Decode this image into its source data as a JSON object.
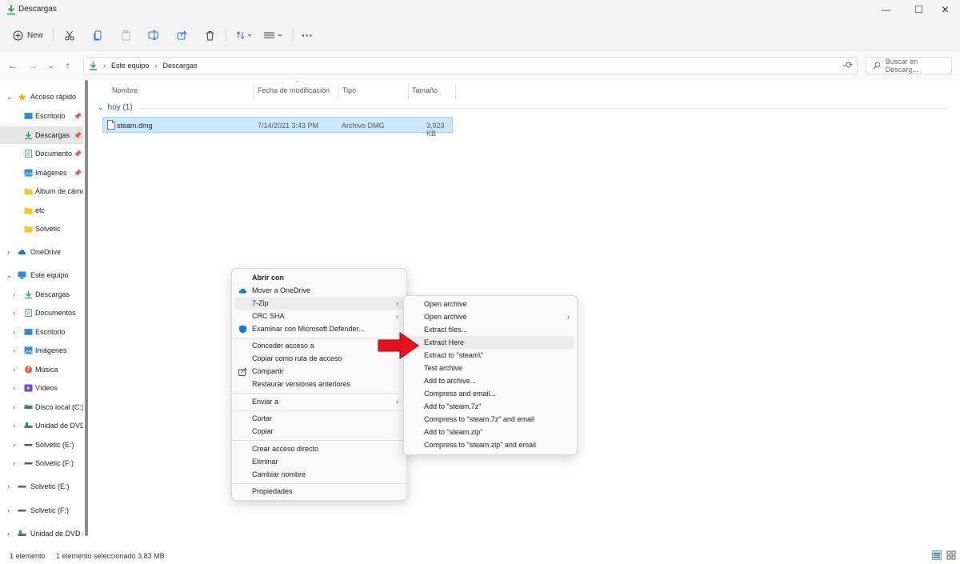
{
  "window": {
    "title": "Descargas",
    "minimize": "—",
    "maximize": "☐",
    "close": "✕"
  },
  "toolbar": {
    "new_label": "New"
  },
  "address": {
    "root": "Este equipo",
    "current": "Descargas",
    "search_placeholder": "Buscar en Descarg..."
  },
  "nav": {
    "quick_access": "Acceso rápido",
    "quick_items": [
      "Escritorio",
      "Descargas",
      "Documento",
      "Imágenes",
      "Álbum de cáma",
      "etc",
      "Solvetic"
    ],
    "onedrive": "OneDrive",
    "this_pc": "Este equipo",
    "pc_items": [
      "Descargas",
      "Documentos",
      "Escritorio",
      "Imágenes",
      "Música",
      "Vídeos",
      "Disco local (C:)",
      "Unidad de DVD",
      "Solvetic (E:)",
      "Solvetic (F:)"
    ],
    "root_items": [
      "Solvetic (E:)",
      "Solvetic (F:)",
      "Unidad de DVD ("
    ]
  },
  "columns": [
    "Nombre",
    "Fecha de modificación",
    "Tipo",
    "Tamaño"
  ],
  "group": {
    "label": "hoy (1)"
  },
  "file": {
    "name": "steam.dmg",
    "date": "7/14/2021 3:43 PM",
    "type": "Archivo DMG",
    "size": "3,923 KB"
  },
  "status": {
    "count": "1 elemento",
    "selected": "1 elemento seleccionado  3.83 MB"
  },
  "context_menu": {
    "items": [
      "Abrir con",
      "Mover a OneDrive",
      "7-Zip",
      "CRC SHA",
      "Examinar con Microsoft Defender...",
      "Conceder acceso a",
      "Copiar como ruta de acceso",
      "Compartir",
      "Restaurar versiones anteriores",
      "Enviar a",
      "Cortar",
      "Copiar",
      "Crear acceso directo",
      "Eliminar",
      "Cambiar nombre",
      "Propiedades"
    ]
  },
  "submenu": {
    "items": [
      "Open archive",
      "Open archive",
      "Extract files...",
      "Extract Here",
      "Extract to \"steam\\\"",
      "Test archive",
      "Add to archive...",
      "Compress and email...",
      "Add to \"steam.7z\"",
      "Compress to \"steam.7z\" and email",
      "Add to \"steam.zip\"",
      "Compress to \"steam.zip\" and email"
    ]
  },
  "colors": {
    "accent": "#0067c0",
    "selection": "#cce8ff",
    "arrow": "#e81123",
    "folder": "#f8c52a"
  }
}
